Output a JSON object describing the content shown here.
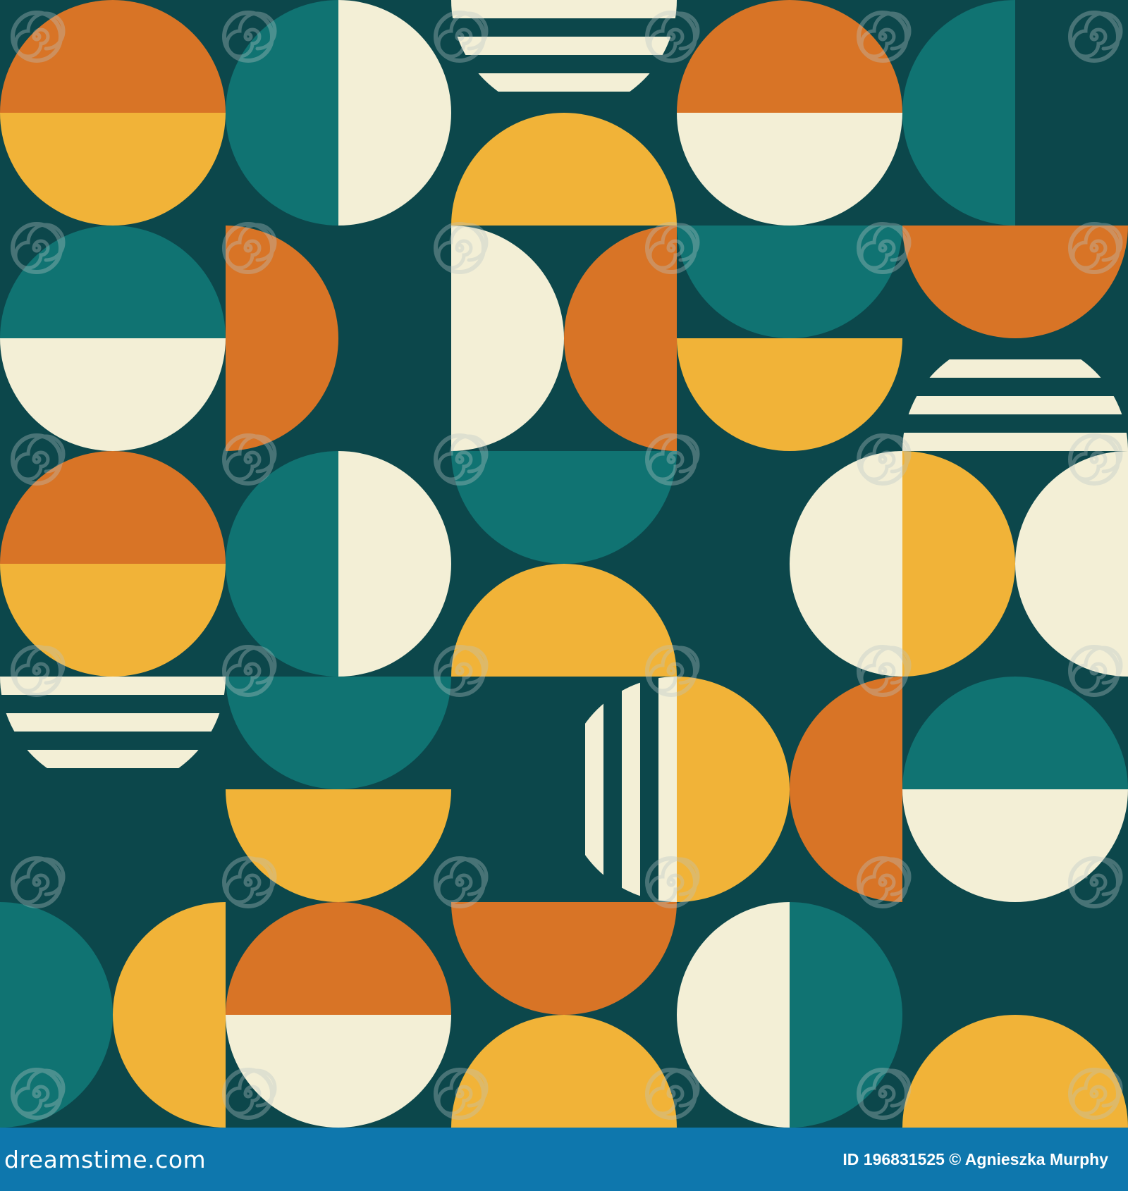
{
  "colors": {
    "background": "#0c474b",
    "orange": "#d87426",
    "yellow": "#f1b338",
    "cream": "#f3efd6",
    "teal": "#107372",
    "footer": "#0e77ad",
    "watermark": "#b9c6c6"
  },
  "watermark": {
    "icon": "spiral-icon",
    "text": "dreamstime"
  },
  "footer": {
    "brand": "dreamstime.com",
    "credit": "ID 196831525 © Agnieszka Murphy"
  }
}
